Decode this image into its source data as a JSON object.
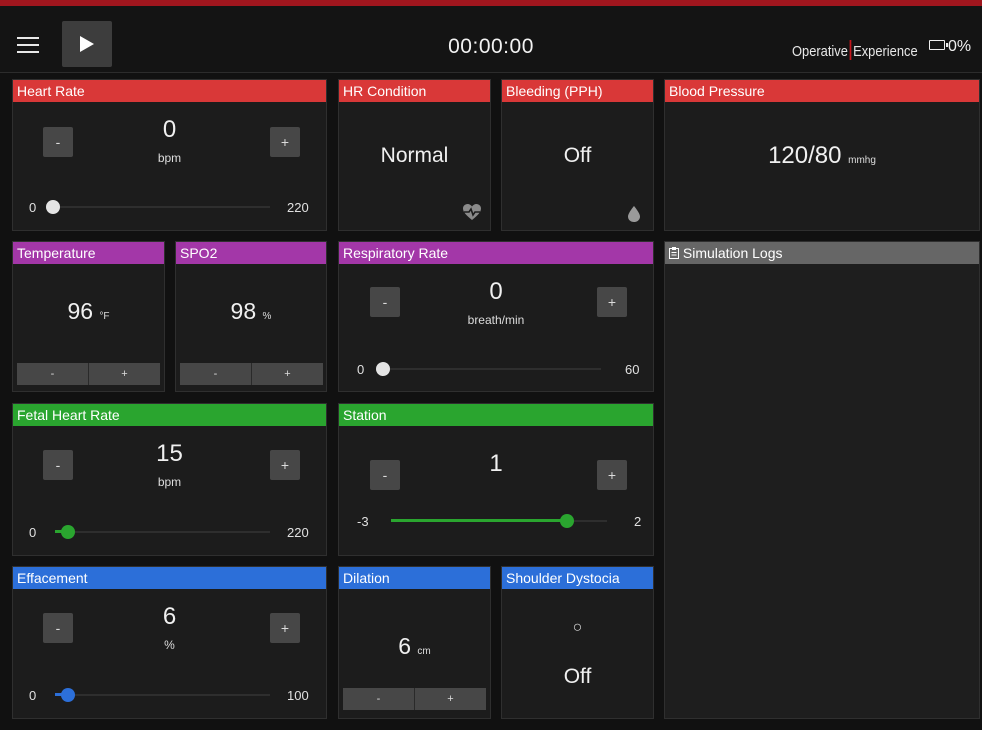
{
  "topbar": {
    "timer": "00:00:00",
    "brand_left": "Operative",
    "brand_right": "Experience",
    "battery": "0%"
  },
  "heart_rate": {
    "title": "Heart Rate",
    "value": "0",
    "unit": "bpm",
    "min": "0",
    "max": "220",
    "level": 0.0,
    "minus": "-",
    "plus": "+"
  },
  "hr_condition": {
    "title": "HR Condition",
    "value": "Normal",
    "icon": "heart-pulse-icon"
  },
  "bleeding": {
    "title": "Bleeding (PPH)",
    "value": "Off",
    "icon": "blood-drop-icon"
  },
  "blood_pressure": {
    "title": "Blood Pressure",
    "value": "120/80",
    "unit": "mmhg"
  },
  "temperature": {
    "title": "Temperature",
    "value": "96",
    "unit": "°F",
    "minus": "-",
    "plus": "+"
  },
  "spo2": {
    "title": "SPO2",
    "value": "98",
    "unit": "%",
    "minus": "-",
    "plus": "+"
  },
  "respiratory_rate": {
    "title": "Respiratory Rate",
    "value": "0",
    "unit": "breath/min",
    "min": "0",
    "max": "60",
    "level": 0.0,
    "minus": "-",
    "plus": "+"
  },
  "simulation_logs": {
    "title": "Simulation Logs",
    "icon": "clipboard-icon"
  },
  "fetal_heart_rate": {
    "title": "Fetal Heart Rate",
    "value": "15",
    "unit": "bpm",
    "min": "0",
    "max": "220",
    "level": 0.068,
    "minus": "-",
    "plus": "+"
  },
  "station": {
    "title": "Station",
    "value": "1",
    "min": "-3",
    "max": "2",
    "level": 0.8,
    "minus": "-",
    "plus": "+"
  },
  "effacement": {
    "title": "Effacement",
    "value": "6",
    "unit": "%",
    "min": "0",
    "max": "100",
    "level": 0.06,
    "minus": "-",
    "plus": "+"
  },
  "dilation": {
    "title": "Dilation",
    "value": "6",
    "unit": "cm",
    "minus": "-",
    "plus": "+"
  },
  "shoulder_dystocia": {
    "title": "Shoulder Dystocia",
    "symbol": "○",
    "value": "Off"
  },
  "colors": {
    "red": "#d93838",
    "purple": "#a337a8",
    "green": "#2aa52f",
    "blue": "#2c6fd9",
    "gray": "#666666",
    "brand_accent": "#c4161c"
  }
}
